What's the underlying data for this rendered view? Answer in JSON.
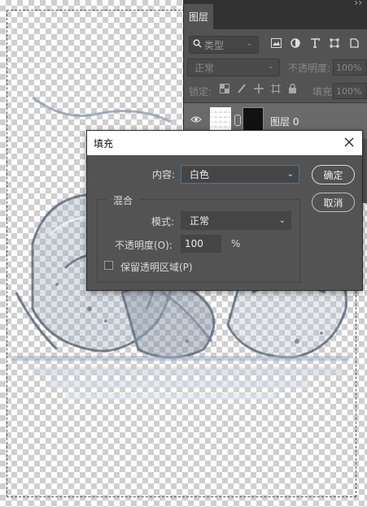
{
  "layers_panel": {
    "tab_label": "图层",
    "panel_menu": "››",
    "filter_type": "类型",
    "blend_mode": "正常",
    "opacity_label": "不透明度:",
    "opacity_value": "100%",
    "lock_label": "锁定:",
    "fill_label": "填充:",
    "fill_value": "100%",
    "layer": {
      "name": "图层 0"
    }
  },
  "fill_dialog": {
    "title": "填充",
    "content_label": "内容:",
    "content_value": "白色",
    "blend_group_title": "混合",
    "mode_label": "模式:",
    "mode_value": "正常",
    "opacity_label": "不透明度(O):",
    "opacity_value": "100",
    "opacity_unit": "%",
    "preserve_transparency_label": "保留透明区域(P)",
    "preserve_transparency_checked": false,
    "ok_label": "确定",
    "cancel_label": "取消"
  },
  "colors": {
    "panel_bg": "#535353",
    "tabbar_bg": "#323232",
    "selected_layer_bg": "#6a6a6a",
    "focus_border": "#3c78c6"
  }
}
